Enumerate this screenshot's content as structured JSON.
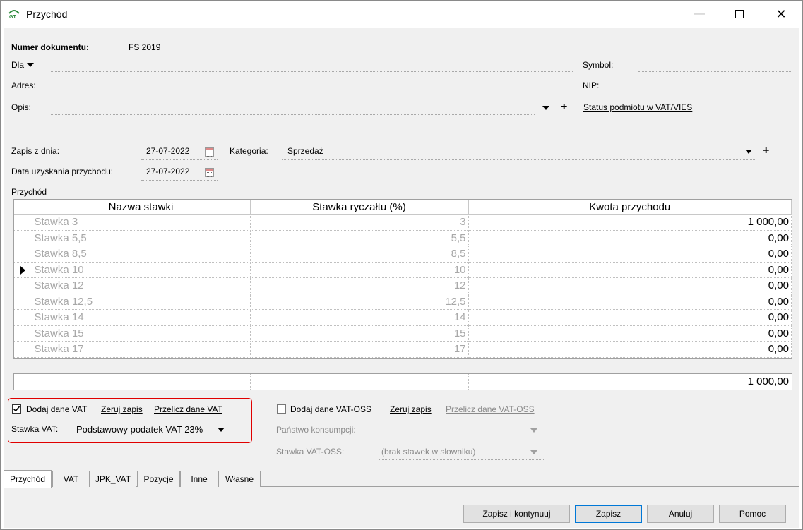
{
  "window": {
    "title": "Przychód"
  },
  "header": {
    "doc_number_label": "Numer dokumentu:",
    "doc_number_value": "FS 2019",
    "for_label": "Dla",
    "address_label": "Adres:",
    "description_label": "Opis:",
    "symbol_label": "Symbol:",
    "nip_label": "NIP:",
    "vat_status_link": "Status podmiotu w VAT/VIES"
  },
  "dates": {
    "record_date_label": "Zapis z dnia:",
    "record_date_value": "27-07-2022",
    "income_date_label": "Data uzyskania przychodu:",
    "income_date_value": "27-07-2022",
    "category_label": "Kategoria:",
    "category_value": "Sprzedaż"
  },
  "income_section_label": "Przychód",
  "grid": {
    "columns": [
      "Nazwa stawki",
      "Stawka ryczałtu (%)",
      "Kwota przychodu"
    ],
    "rows": [
      {
        "name": "Stawka 3",
        "rate": "3",
        "amount": "1 000,00"
      },
      {
        "name": "Stawka 5,5",
        "rate": "5,5",
        "amount": "0,00"
      },
      {
        "name": "Stawka 8,5",
        "rate": "8,5",
        "amount": "0,00"
      },
      {
        "name": "Stawka 10",
        "rate": "10",
        "amount": "0,00"
      },
      {
        "name": "Stawka 12",
        "rate": "12",
        "amount": "0,00"
      },
      {
        "name": "Stawka 12,5",
        "rate": "12,5",
        "amount": "0,00"
      },
      {
        "name": "Stawka 14",
        "rate": "14",
        "amount": "0,00"
      },
      {
        "name": "Stawka 15",
        "rate": "15",
        "amount": "0,00"
      },
      {
        "name": "Stawka 17",
        "rate": "17",
        "amount": "0,00"
      }
    ],
    "total": "1 000,00"
  },
  "vat": {
    "add_vat_label": "Dodaj dane VAT",
    "add_vat_checked": true,
    "reset_link": "Zeruj zapis",
    "recalc_link": "Przelicz dane VAT",
    "rate_label": "Stawka VAT:",
    "rate_value": "Podstawowy podatek VAT 23%"
  },
  "vat_oss": {
    "add_label": "Dodaj dane VAT-OSS",
    "add_checked": false,
    "reset_link": "Zeruj zapis",
    "recalc_link": "Przelicz dane VAT-OSS",
    "country_label": "Państwo konsumpcji:",
    "country_value": "",
    "rate_label": "Stawka VAT-OSS:",
    "rate_value": "(brak stawek w słowniku)"
  },
  "tabs": [
    "Przychód",
    "VAT",
    "JPK_VAT",
    "Pozycje",
    "Inne",
    "Własne"
  ],
  "buttons": {
    "save_continue": "Zapisz i kontynuuj",
    "save": "Zapisz",
    "cancel": "Anuluj",
    "help": "Pomoc"
  }
}
